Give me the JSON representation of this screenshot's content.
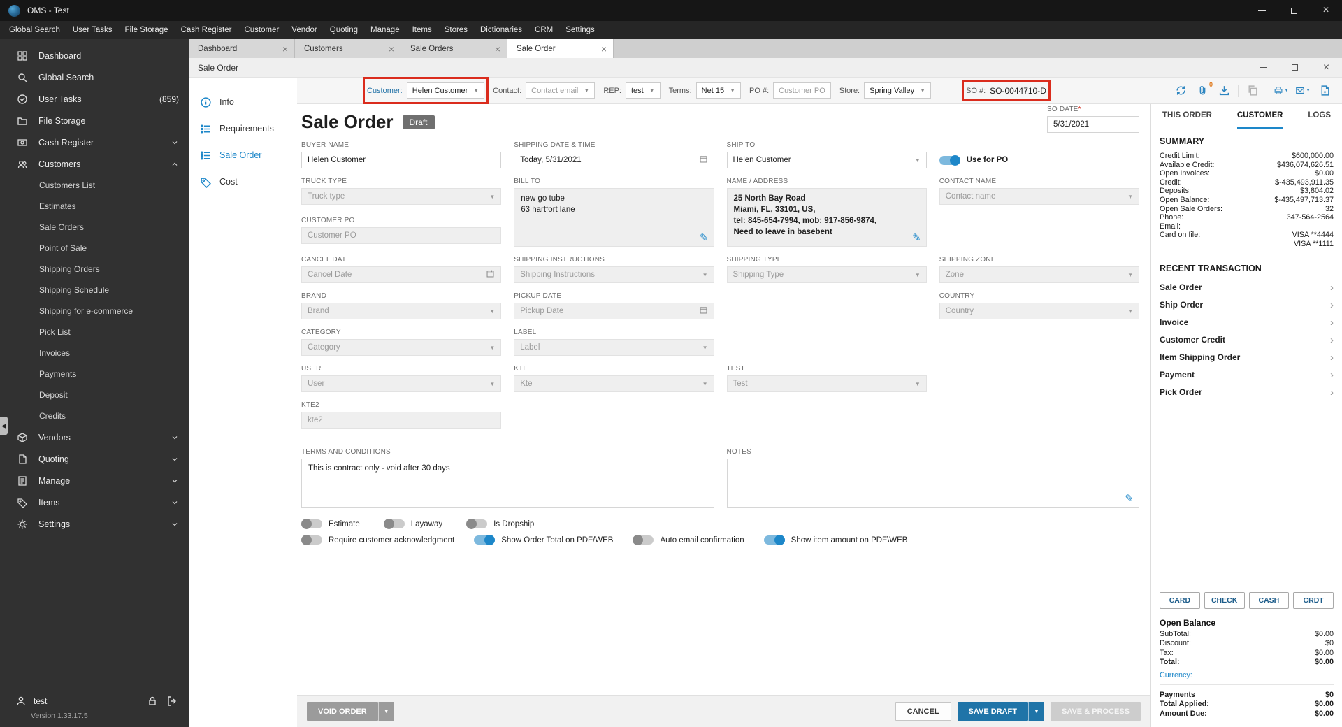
{
  "colors": {
    "accent": "#1d87c9",
    "annotation": "#da2c1d"
  },
  "titlebar": {
    "title": "OMS - Test"
  },
  "menubar": {
    "items": [
      "Global Search",
      "User Tasks",
      "File Storage",
      "Cash Register",
      "Customer",
      "Vendor",
      "Quoting",
      "Manage",
      "Items",
      "Stores",
      "Dictionaries",
      "CRM",
      "Settings"
    ]
  },
  "sidebar": {
    "dashboard": "Dashboard",
    "global_search": "Global Search",
    "user_tasks": "User Tasks",
    "user_tasks_badge": "(859)",
    "file_storage": "File Storage",
    "cash_register": "Cash Register",
    "customers": "Customers",
    "customers_subitems": [
      "Customers List",
      "Estimates",
      "Sale Orders",
      "Point of Sale",
      "Shipping Orders",
      "Shipping Schedule",
      "Shipping for e-commerce",
      "Pick List",
      "Invoices",
      "Payments",
      "Deposit",
      "Credits"
    ],
    "vendors": "Vendors",
    "quoting": "Quoting",
    "manage": "Manage",
    "items": "Items",
    "settings": "Settings",
    "user": "test",
    "version": "Version 1.33.17.5"
  },
  "tabbar": {
    "tabs": [
      {
        "label": "Dashboard"
      },
      {
        "label": "Customers"
      },
      {
        "label": "Sale Orders"
      },
      {
        "label": "Sale Order"
      }
    ]
  },
  "window": {
    "title": "Sale Order"
  },
  "toolbar": {
    "customer_label": "Customer:",
    "customer_value": "Helen Customer",
    "contact_label": "Contact:",
    "contact_placeholder": "Contact email",
    "rep_label": "REP:",
    "rep_value": "test",
    "terms_label": "Terms:",
    "terms_value": "Net 15",
    "po_label": "PO #:",
    "po_placeholder": "Customer PO",
    "store_label": "Store:",
    "store_value": "Spring Valley",
    "so_label": "SO #:",
    "so_value": "SO-0044710-D",
    "attach_count": "0"
  },
  "nav": {
    "info": "Info",
    "requirements": "Requirements",
    "sale_order": "Sale Order",
    "cost": "Cost"
  },
  "form": {
    "title": "Sale Order",
    "badge": "Draft",
    "so_date": {
      "label": "SO DATE",
      "required": "*",
      "value": "5/31/2021"
    },
    "buyer_name": {
      "label": "BUYER NAME",
      "value": "Helen Customer"
    },
    "shipping_date": {
      "label": "SHIPPING DATE & TIME",
      "value": "Today, 5/31/2021"
    },
    "ship_to": {
      "label": "SHIP TO",
      "value": "Helen Customer"
    },
    "use_for_po": {
      "label": "Use for PO",
      "on": true
    },
    "truck_type": {
      "label": "TRUCK TYPE",
      "placeholder": "Truck type"
    },
    "bill_to": {
      "label": "BILL TO",
      "line1": "new go tube",
      "line2": "63 hartfort lane"
    },
    "name_address": {
      "label": "NAME / ADDRESS",
      "line1": "25 North Bay Road",
      "line2": "Miami, FL, 33101, US,",
      "line3": "tel: 845-654-7994, mob: 917-856-9874,",
      "line4": "Need to leave in basebent"
    },
    "contact_name": {
      "label": "CONTACT NAME",
      "placeholder": "Contact name"
    },
    "customer_po": {
      "label": "CUSTOMER PO",
      "placeholder": "Customer PO"
    },
    "cancel_date": {
      "label": "CANCEL DATE",
      "placeholder": "Cancel Date"
    },
    "shipping_instructions": {
      "label": "SHIPPING INSTRUCTIONS",
      "placeholder": "Shipping Instructions"
    },
    "shipping_type": {
      "label": "SHIPPING TYPE",
      "placeholder": "Shipping Type"
    },
    "shipping_zone": {
      "label": "SHIPPING ZONE",
      "placeholder": "Zone"
    },
    "brand": {
      "label": "BRAND",
      "placeholder": "Brand"
    },
    "pickup_date": {
      "label": "PICKUP DATE",
      "placeholder": "Pickup Date"
    },
    "country": {
      "label": "COUNTRY",
      "placeholder": "Country"
    },
    "category": {
      "label": "CATEGORY",
      "placeholder": "Category"
    },
    "label_field": {
      "label": "LABEL",
      "placeholder": "Label"
    },
    "user": {
      "label": "USER",
      "placeholder": "User"
    },
    "kte": {
      "label": "KTE",
      "placeholder": "Kte"
    },
    "test": {
      "label": "TEST",
      "placeholder": "Test"
    },
    "kte2": {
      "label": "KTE2",
      "placeholder": "kte2"
    },
    "terms_conditions": {
      "label": "TERMS AND CONDITIONS",
      "value": "This is contract only - void after 30 days"
    },
    "notes": {
      "label": "NOTES",
      "value": ""
    },
    "toggle_estimate": {
      "label": "Estimate",
      "on": false
    },
    "toggle_layaway": {
      "label": "Layaway",
      "on": false
    },
    "toggle_dropship": {
      "label": "Is Dropship",
      "on": false
    },
    "toggle_ack": {
      "label": "Require customer acknowledgment",
      "on": false
    },
    "toggle_show_total": {
      "label": "Show Order Total on PDF/WEB",
      "on": true
    },
    "toggle_auto_email": {
      "label": "Auto email confirmation",
      "on": false
    },
    "toggle_show_item": {
      "label": "Show item amount on PDF\\WEB",
      "on": true
    }
  },
  "footer": {
    "void_label": "VOID ORDER",
    "cancel_label": "CANCEL",
    "save_draft_label": "SAVE DRAFT",
    "save_process_label": "SAVE & PROCESS"
  },
  "panel": {
    "tabs": {
      "this_order": "THIS ORDER",
      "customer": "CUSTOMER",
      "logs": "LOGS"
    },
    "summary_title": "SUMMARY",
    "summary_rows": [
      {
        "label": "Credit Limit:",
        "value": "$600,000.00"
      },
      {
        "label": "Available Credit:",
        "value": "$436,074,626.51"
      },
      {
        "label": "Open Invoices:",
        "value": "$0.00"
      },
      {
        "label": "Credit:",
        "value": "$-435,493,911.35"
      },
      {
        "label": "Deposits:",
        "value": "$3,804.02"
      },
      {
        "label": "Open Balance:",
        "value": "$-435,497,713.37"
      },
      {
        "label": "Open Sale Orders:",
        "value": "32"
      },
      {
        "label": "Phone:",
        "value": "347-564-2564"
      },
      {
        "label": "Email:",
        "value": ""
      },
      {
        "label": "Card on file:",
        "value": "VISA **4444"
      },
      {
        "label": "",
        "value": "VISA **1111"
      }
    ],
    "recent_title": "RECENT TRANSACTION",
    "recent_items": [
      "Sale Order",
      "Ship Order",
      "Invoice",
      "Customer Credit",
      "Item Shipping Order",
      "Payment",
      "Pick Order"
    ],
    "pay_buttons": [
      "CARD",
      "CHECK",
      "CASH",
      "CRDT"
    ],
    "totals_title": "Open Balance",
    "totals": [
      {
        "label": "SubTotal:",
        "value": "$0.00"
      },
      {
        "label": "Discount:",
        "value": "$0"
      },
      {
        "label": "Tax:",
        "value": "$0.00"
      },
      {
        "label": "Total:",
        "value": "$0.00"
      }
    ],
    "currency_label": "Currency:",
    "payments": [
      {
        "label": "Payments",
        "value": "$0"
      },
      {
        "label": "Total Applied:",
        "value": "$0.00"
      },
      {
        "label": "Amount Due:",
        "value": "$0.00"
      }
    ]
  }
}
